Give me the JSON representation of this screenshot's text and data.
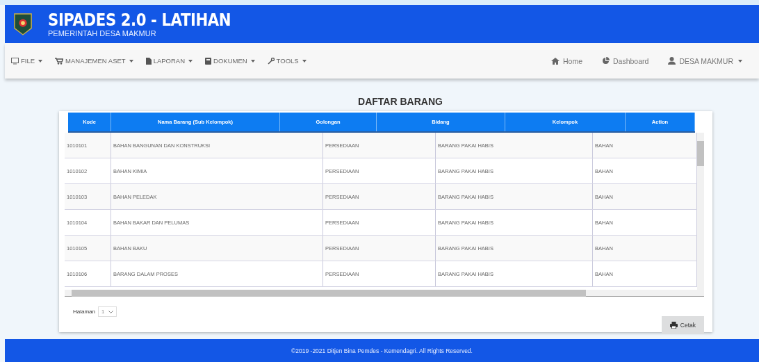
{
  "header": {
    "title": "SIPADES 2.0 - LATIHAN",
    "subtitle": "PEMERINTAH DESA MAKMUR"
  },
  "menu": [
    {
      "label": "FILE"
    },
    {
      "label": "MANAJEMEN ASET"
    },
    {
      "label": "LAPORAN"
    },
    {
      "label": "DOKUMEN"
    },
    {
      "label": "TOOLS"
    }
  ],
  "nav_right": [
    {
      "label": "Home",
      "dropdown": false
    },
    {
      "label": "Dashboard",
      "dropdown": false
    },
    {
      "label": "DESA MAKMUR",
      "dropdown": true
    }
  ],
  "page_title": "DAFTAR BARANG",
  "table": {
    "columns": [
      "Kode",
      "Nama Barang (Sub Kelompok)",
      "Golongan",
      "Bidang",
      "Kelompok",
      "Action"
    ],
    "rows": [
      [
        "1010101",
        "BAHAN BANGUNAN DAN KONSTRUKSI",
        "PERSEDIAAN",
        "BARANG PAKAI HABIS",
        "BAHAN"
      ],
      [
        "1010102",
        "BAHAN KIMIA",
        "PERSEDIAAN",
        "BARANG PAKAI HABIS",
        "BAHAN"
      ],
      [
        "1010103",
        "BAHAN PELEDAK",
        "PERSEDIAAN",
        "BARANG PAKAI HABIS",
        "BAHAN"
      ],
      [
        "1010104",
        "BAHAN BAKAR DAN PELUMAS",
        "PERSEDIAAN",
        "BARANG PAKAI HABIS",
        "BAHAN"
      ],
      [
        "1010105",
        "BAHAN BAKU",
        "PERSEDIAAN",
        "BARANG PAKAI HABIS",
        "BAHAN"
      ],
      [
        "1010106",
        "BARANG DALAM PROSES",
        "PERSEDIAAN",
        "BARANG PAKAI HABIS",
        "BAHAN"
      ]
    ]
  },
  "pagination": {
    "label": "Halaman",
    "value": "1"
  },
  "print_button": "Cetak",
  "footer": "©2019 -2021 Ditjen Bina Pemdes - Kemendagri. All Rights Reserved."
}
